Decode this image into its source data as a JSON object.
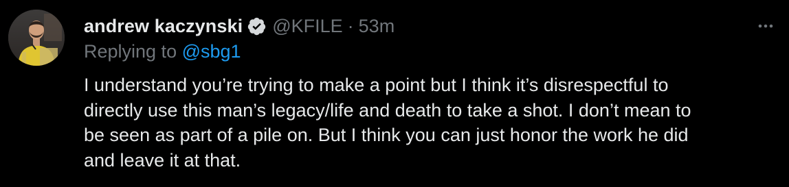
{
  "tweet": {
    "author": {
      "display_name": "andrew kaczynski",
      "verified_icon": "verified-badge-icon",
      "handle": "@KFILE",
      "separator": "·",
      "timestamp": "53m"
    },
    "more_icon": "more-dots-icon",
    "reply_context": {
      "prefix": "Replying to",
      "mention": "@sbg1"
    },
    "body_lines": [
      "I understand you’re trying to make a point but I think it’s disrespectful to",
      "directly use this man’s legacy/life and death to take a shot. I don’t mean to",
      "be seen as part of a pile on. But I think you can just honor the work he did",
      "and leave it at that."
    ]
  },
  "colors": {
    "background": "#000000",
    "primary_text": "#e7e9ea",
    "secondary_text": "#71767b",
    "link": "#1d9bf0",
    "verified_badge": "#d6d9db"
  }
}
